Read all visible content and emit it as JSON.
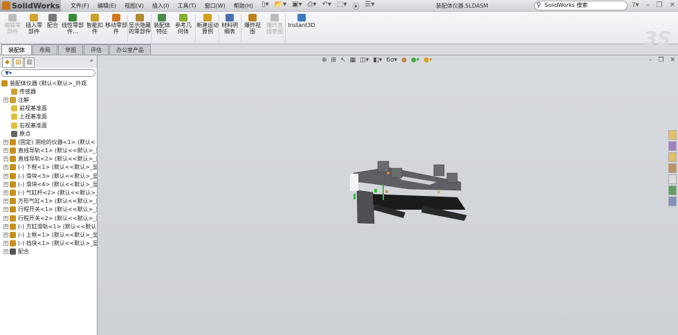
{
  "app": {
    "name": "SolidWorks",
    "document_title": "装配体仪器.SLDASM",
    "search_placeholder": "SolidWorks 搜索"
  },
  "menu": [
    "文件(F)",
    "编辑(E)",
    "视图(V)",
    "插入(I)",
    "工具(T)",
    "窗口(W)",
    "帮助(H)"
  ],
  "ribbon": [
    {
      "label": "编辑零部件",
      "disabled": true,
      "color": "#bbbbbb"
    },
    {
      "label": "插入零部件",
      "disabled": false,
      "color": "#d4a22a"
    },
    {
      "label": "配合",
      "disabled": false,
      "color": "#777777"
    },
    {
      "label": "线性零部件...",
      "disabled": false,
      "color": "#3a8a3a"
    },
    {
      "label": "智能扣件",
      "disabled": false,
      "color": "#c9a02a"
    },
    {
      "label": "移动零部件",
      "disabled": false,
      "color": "#d07a20"
    },
    {
      "label": "显示隐藏的零部件",
      "disabled": false,
      "color": "#b08a30"
    },
    {
      "label": "装配体特征",
      "disabled": false,
      "color": "#4a8a4a"
    },
    {
      "label": "参考几何体",
      "disabled": false,
      "color": "#8ab030"
    },
    {
      "label": "新建运动算例",
      "disabled": false,
      "color": "#d0a020"
    },
    {
      "label": "材料明细表",
      "disabled": false,
      "color": "#4a70b0"
    },
    {
      "label": "爆炸视图",
      "disabled": false,
      "color": "#c08020"
    },
    {
      "label": "爆炸直线草图",
      "disabled": true,
      "color": "#bbbbbb"
    },
    {
      "label": "Instant3D",
      "disabled": false,
      "color": "#3a7ac0"
    }
  ],
  "tabs": [
    "装配体",
    "布局",
    "草图",
    "评估",
    "办公室产品"
  ],
  "active_tab": "装配体",
  "feature_tree": [
    {
      "label": "装配体仪器  (默认<默认>_外观",
      "expand": false,
      "root": true,
      "color": "#c8901a"
    },
    {
      "label": "传感器",
      "expand": false,
      "color": "#d0a030"
    },
    {
      "label": "注解",
      "expand": true,
      "color": "#d0a030"
    },
    {
      "label": "前视基准面",
      "expand": false,
      "color": "#e0c040"
    },
    {
      "label": "上视基准面",
      "expand": false,
      "color": "#e0c040"
    },
    {
      "label": "右视基准面",
      "expand": false,
      "color": "#e0c040"
    },
    {
      "label": "原点",
      "expand": false,
      "color": "#666666"
    },
    {
      "label": "(固定) 测绘的仪器<1> (默认<",
      "expand": true,
      "color": "#c8901a"
    },
    {
      "label": "直线导轨<1> (默认<<默认>_显",
      "expand": true,
      "color": "#c8901a"
    },
    {
      "label": "直线导轨<2> (默认<<默认>_显",
      "expand": true,
      "color": "#c8901a"
    },
    {
      "label": "(-) 下框<1> (默认<<默认>_显",
      "expand": true,
      "color": "#c8901a"
    },
    {
      "label": "(-) 滑块<3> (默认<<默认>_显",
      "expand": true,
      "color": "#c8901a"
    },
    {
      "label": "(-) 滑块<4> (默认<<默认>_显",
      "expand": true,
      "color": "#c8901a"
    },
    {
      "label": "(-) 气缸杆<2> (默认<<默认>_",
      "expand": true,
      "color": "#c8901a"
    },
    {
      "label": "方形气缸<1> (默认<<默认>_显",
      "expand": true,
      "color": "#c8901a"
    },
    {
      "label": "行程开关<1> (默认<<默认>_显",
      "expand": true,
      "color": "#c8901a"
    },
    {
      "label": "行程开关<2> (默认<<默认>_显",
      "expand": true,
      "color": "#c8901a"
    },
    {
      "label": "(-) 方缸滑轨<1> (默认<<默认",
      "expand": true,
      "color": "#c8901a"
    },
    {
      "label": "(-) 上框<1> (默认<<默认>_显",
      "expand": true,
      "color": "#c8901a"
    },
    {
      "label": "(-) 挡块<1> (默认<<默认>_显",
      "expand": true,
      "color": "#c8901a"
    },
    {
      "label": "配合",
      "expand": true,
      "color": "#555555"
    }
  ],
  "fm_expand_label": "»"
}
